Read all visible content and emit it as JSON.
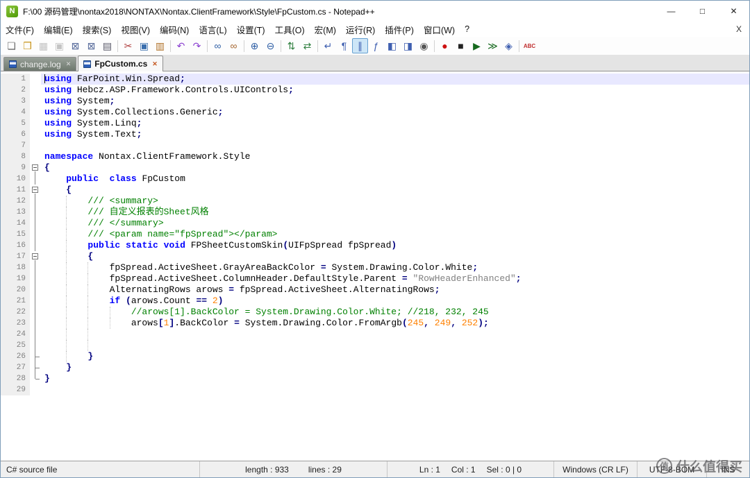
{
  "window": {
    "title": "F:\\00 源码管理\\nontax2018\\NONTAX\\Nontax.ClientFramework\\Style\\FpCustom.cs - Notepad++",
    "app_icon_letter": "N",
    "controls": {
      "minimize": "—",
      "maximize": "□",
      "close": "✕"
    }
  },
  "menu": {
    "items": [
      "文件(F)",
      "编辑(E)",
      "搜索(S)",
      "视图(V)",
      "编码(N)",
      "语言(L)",
      "设置(T)",
      "工具(O)",
      "宏(M)",
      "运行(R)",
      "插件(P)",
      "窗口(W)",
      "?"
    ],
    "right_close": "X"
  },
  "toolbar": {
    "icons": [
      {
        "name": "new-file",
        "glyph": "❏",
        "color": "#6a6a6a"
      },
      {
        "name": "open-file",
        "glyph": "❒",
        "color": "#c89418"
      },
      {
        "name": "save-file",
        "glyph": "▦",
        "color": "#b9b9b9",
        "disabled": true
      },
      {
        "name": "save-all",
        "glyph": "▣",
        "color": "#b9b9b9",
        "disabled": true
      },
      {
        "name": "close-file",
        "glyph": "⊠",
        "color": "#55699a"
      },
      {
        "name": "close-all",
        "glyph": "⊠",
        "color": "#55699a"
      },
      {
        "name": "print",
        "glyph": "▤",
        "color": "#556"
      },
      {
        "sep": true
      },
      {
        "name": "cut",
        "glyph": "✂",
        "color": "#b04040"
      },
      {
        "name": "copy",
        "glyph": "▣",
        "color": "#3a6fae"
      },
      {
        "name": "paste",
        "glyph": "▥",
        "color": "#b0722a"
      },
      {
        "sep": true
      },
      {
        "name": "undo",
        "glyph": "↶",
        "color": "#8a3fd0"
      },
      {
        "name": "redo",
        "glyph": "↷",
        "color": "#8a3fd0"
      },
      {
        "sep": true
      },
      {
        "name": "find",
        "glyph": "∞",
        "color": "#2f5fa5"
      },
      {
        "name": "replace",
        "glyph": "∞",
        "color": "#a5662f"
      },
      {
        "sep": true
      },
      {
        "name": "zoom-in",
        "glyph": "⊕",
        "color": "#2f5fa5"
      },
      {
        "name": "zoom-out",
        "glyph": "⊖",
        "color": "#2f5fa5"
      },
      {
        "sep": true
      },
      {
        "name": "sync-vertical-scroll",
        "glyph": "⇅",
        "color": "#2f7f3f"
      },
      {
        "name": "sync-horizontal-scroll",
        "glyph": "⇄",
        "color": "#2f7f3f"
      },
      {
        "sep": true
      },
      {
        "name": "word-wrap",
        "glyph": "↵",
        "color": "#3f5fb0"
      },
      {
        "name": "show-all-chars",
        "glyph": "¶",
        "color": "#3f5fb0"
      },
      {
        "name": "indent-guide",
        "glyph": "∥",
        "color": "#3f5fb0",
        "active": true
      },
      {
        "name": "function-list",
        "glyph": "ƒ",
        "color": "#3f5fb0"
      },
      {
        "name": "document-map",
        "glyph": "◧",
        "color": "#3f5fb0"
      },
      {
        "name": "document-switcher",
        "glyph": "◨",
        "color": "#3f5fb0"
      },
      {
        "name": "file-monitoring",
        "glyph": "◉",
        "color": "#555555"
      },
      {
        "sep": true
      },
      {
        "name": "record-macro",
        "glyph": "●",
        "color": "#cc1111"
      },
      {
        "name": "stop-macro",
        "glyph": "■",
        "color": "#222222"
      },
      {
        "name": "play-macro",
        "glyph": "▶",
        "color": "#17691f"
      },
      {
        "name": "run-macro-multiple",
        "glyph": "≫",
        "color": "#17691f"
      },
      {
        "name": "save-macro",
        "glyph": "◈",
        "color": "#3f5fb0"
      },
      {
        "sep": true
      },
      {
        "name": "spell-check",
        "glyph": "ABC",
        "color": "#c03030"
      }
    ]
  },
  "tabs": {
    "close_glyph": "✕",
    "items": [
      {
        "label": "change.log",
        "active": false
      },
      {
        "label": "FpCustom.cs",
        "active": true
      }
    ]
  },
  "colors": {
    "kw": "#0000ff",
    "pl": "#000000",
    "com": "#008000",
    "str": "#808080",
    "num": "#ff8000",
    "op": "#000080"
  },
  "editor": {
    "lines": [
      {
        "n": 1,
        "fold": "",
        "cur": true,
        "s": [
          [
            "using",
            "kw"
          ],
          [
            " FarPoint.Win.Spread",
            "pl"
          ],
          [
            ";",
            "op"
          ]
        ]
      },
      {
        "n": 2,
        "fold": "",
        "s": [
          [
            "using",
            "kw"
          ],
          [
            " Hebcz.ASP.Framework.Controls.UIControls",
            "pl"
          ],
          [
            ";",
            "op"
          ]
        ]
      },
      {
        "n": 3,
        "fold": "",
        "s": [
          [
            "using",
            "kw"
          ],
          [
            " System",
            "pl"
          ],
          [
            ";",
            "op"
          ]
        ]
      },
      {
        "n": 4,
        "fold": "",
        "s": [
          [
            "using",
            "kw"
          ],
          [
            " System.Collections.Generic",
            "pl"
          ],
          [
            ";",
            "op"
          ]
        ]
      },
      {
        "n": 5,
        "fold": "",
        "s": [
          [
            "using",
            "kw"
          ],
          [
            " System.Linq",
            "pl"
          ],
          [
            ";",
            "op"
          ]
        ]
      },
      {
        "n": 6,
        "fold": "",
        "s": [
          [
            "using",
            "kw"
          ],
          [
            " System.Text",
            "pl"
          ],
          [
            ";",
            "op"
          ]
        ]
      },
      {
        "n": 7,
        "fold": "",
        "s": []
      },
      {
        "n": 8,
        "fold": "",
        "s": [
          [
            "namespace",
            "kw"
          ],
          [
            " Nontax.ClientFramework.Style",
            "pl"
          ]
        ]
      },
      {
        "n": 9,
        "fold": "box",
        "s": [
          [
            "{",
            "op"
          ]
        ]
      },
      {
        "n": 10,
        "fold": "line",
        "s": [
          [
            "    ",
            "pl"
          ],
          [
            "public",
            "kw"
          ],
          [
            "  ",
            "pl"
          ],
          [
            "class",
            "kw"
          ],
          [
            " FpCustom",
            "pl"
          ]
        ]
      },
      {
        "n": 11,
        "fold": "box",
        "s": [
          [
            "    ",
            "pl"
          ],
          [
            "{",
            "op"
          ]
        ]
      },
      {
        "n": 12,
        "fold": "line",
        "s": [
          [
            "        ",
            "pl"
          ],
          [
            "/// <summary>",
            "com"
          ]
        ]
      },
      {
        "n": 13,
        "fold": "line",
        "s": [
          [
            "        ",
            "pl"
          ],
          [
            "/// 自定义报表的Sheet风格",
            "com"
          ]
        ]
      },
      {
        "n": 14,
        "fold": "line",
        "s": [
          [
            "        ",
            "pl"
          ],
          [
            "/// </summary>",
            "com"
          ]
        ]
      },
      {
        "n": 15,
        "fold": "line",
        "s": [
          [
            "        ",
            "pl"
          ],
          [
            "/// <param name=\"fpSpread\"></param>",
            "com"
          ]
        ]
      },
      {
        "n": 16,
        "fold": "line",
        "s": [
          [
            "        ",
            "pl"
          ],
          [
            "public",
            "kw"
          ],
          [
            " ",
            "pl"
          ],
          [
            "static",
            "kw"
          ],
          [
            " ",
            "pl"
          ],
          [
            "void",
            "kw"
          ],
          [
            " FPSheetCustomSkin",
            "pl"
          ],
          [
            "(",
            "op"
          ],
          [
            "UIFpSpread fpSpread",
            "pl"
          ],
          [
            ")",
            "op"
          ]
        ]
      },
      {
        "n": 17,
        "fold": "box",
        "s": [
          [
            "        ",
            "pl"
          ],
          [
            "{",
            "op"
          ]
        ]
      },
      {
        "n": 18,
        "fold": "line",
        "s": [
          [
            "            fpSpread.ActiveSheet.GrayAreaBackColor ",
            "pl"
          ],
          [
            "=",
            "op"
          ],
          [
            " System.Drawing.Color.White",
            "pl"
          ],
          [
            ";",
            "op"
          ]
        ]
      },
      {
        "n": 19,
        "fold": "line",
        "s": [
          [
            "            fpSpread.ActiveSheet.ColumnHeader.DefaultStyle.Parent ",
            "pl"
          ],
          [
            "=",
            "op"
          ],
          [
            " ",
            "pl"
          ],
          [
            "\"RowHeaderEnhanced\"",
            "str"
          ],
          [
            ";",
            "op"
          ]
        ]
      },
      {
        "n": 20,
        "fold": "line",
        "s": [
          [
            "            AlternatingRows arows ",
            "pl"
          ],
          [
            "=",
            "op"
          ],
          [
            " fpSpread.ActiveSheet.AlternatingRows",
            "pl"
          ],
          [
            ";",
            "op"
          ]
        ]
      },
      {
        "n": 21,
        "fold": "line",
        "s": [
          [
            "            ",
            "pl"
          ],
          [
            "if",
            "kw"
          ],
          [
            " ",
            "pl"
          ],
          [
            "(",
            "op"
          ],
          [
            "arows.Count ",
            "pl"
          ],
          [
            "==",
            "op"
          ],
          [
            " ",
            "pl"
          ],
          [
            "2",
            "num"
          ],
          [
            ")",
            "op"
          ]
        ]
      },
      {
        "n": 22,
        "fold": "line",
        "s": [
          [
            "                ",
            "pl"
          ],
          [
            "//arows[1].BackColor = System.Drawing.Color.White; //218, 232, 245",
            "com"
          ]
        ]
      },
      {
        "n": 23,
        "fold": "line",
        "s": [
          [
            "                arows",
            "pl"
          ],
          [
            "[",
            "op"
          ],
          [
            "1",
            "num"
          ],
          [
            "]",
            "op"
          ],
          [
            ".BackColor ",
            "pl"
          ],
          [
            "=",
            "op"
          ],
          [
            " System.Drawing.Color.FromArgb",
            "pl"
          ],
          [
            "(",
            "op"
          ],
          [
            "245",
            "num"
          ],
          [
            ",",
            "op"
          ],
          [
            " ",
            "pl"
          ],
          [
            "249",
            "num"
          ],
          [
            ",",
            "op"
          ],
          [
            " ",
            "pl"
          ],
          [
            "252",
            "num"
          ],
          [
            ")",
            "op"
          ],
          [
            ";",
            "op"
          ]
        ]
      },
      {
        "n": 24,
        "fold": "line",
        "g": 12,
        "s": []
      },
      {
        "n": 25,
        "fold": "line",
        "g": 12,
        "s": []
      },
      {
        "n": 26,
        "fold": "tee",
        "s": [
          [
            "        ",
            "pl"
          ],
          [
            "}",
            "op"
          ]
        ]
      },
      {
        "n": 27,
        "fold": "tee",
        "s": [
          [
            "    ",
            "pl"
          ],
          [
            "}",
            "op"
          ]
        ]
      },
      {
        "n": 28,
        "fold": "end",
        "s": [
          [
            "}",
            "op"
          ]
        ]
      },
      {
        "n": 29,
        "fold": "",
        "s": []
      }
    ]
  },
  "status_bar": {
    "doc_type": "C# source file",
    "length": "length : 933",
    "lines": "lines : 29",
    "ln": "Ln : 1",
    "col": "Col : 1",
    "sel": "Sel : 0 | 0",
    "eol": "Windows (CR LF)",
    "encoding": "UTF-8-BOM",
    "mode": "INS"
  },
  "watermark": {
    "logo": "值",
    "text": "什么值得买"
  }
}
